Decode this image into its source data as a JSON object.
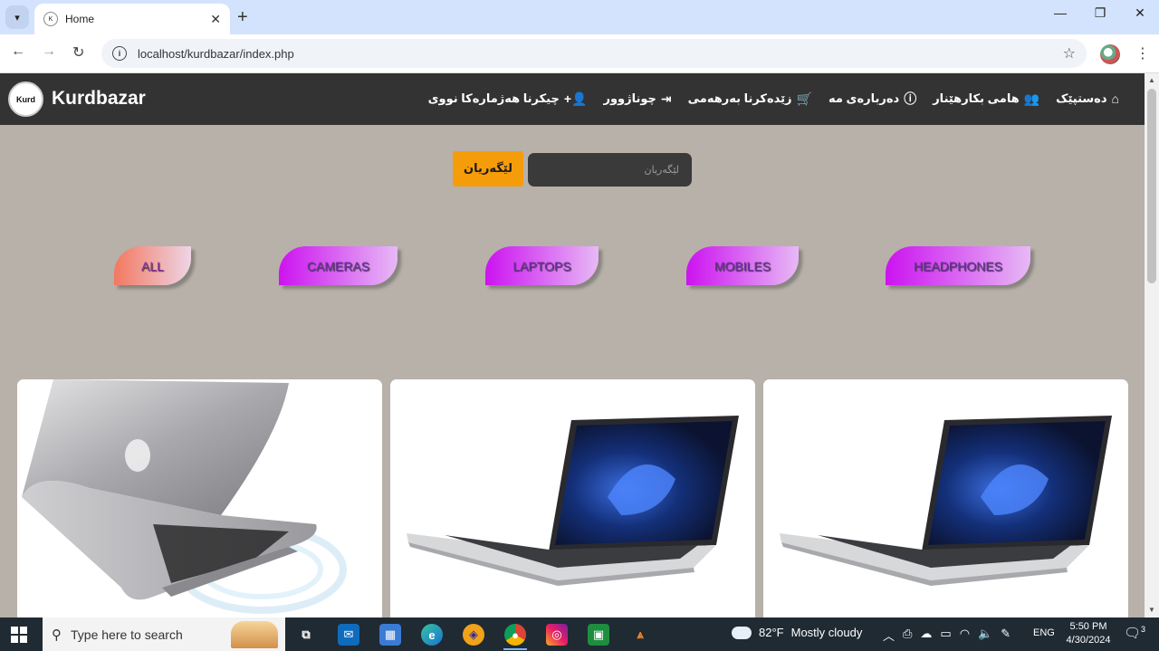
{
  "browser": {
    "tab_title": "Home",
    "url": "localhost/kurdbazar/index.php",
    "new_tab_label": "+",
    "close_tab_label": "✕"
  },
  "site": {
    "brand": "Kurdbazar",
    "logo_text": "Kurd",
    "nav": [
      {
        "label": "دەستپێک",
        "icon": "home-icon"
      },
      {
        "label": "هامی بکارهێنار",
        "icon": "users-icon"
      },
      {
        "label": "دەربارەی مە",
        "icon": "info-icon"
      },
      {
        "label": "زێدەکرنا بەرهەمی",
        "icon": "cart-icon"
      },
      {
        "label": "چوناژوور",
        "icon": "login-icon"
      },
      {
        "label": "چیکرنا هەژمارەکا نووی",
        "icon": "user-plus-icon"
      }
    ],
    "search": {
      "placeholder": "لێگەریان",
      "button_label": "لێگەریان"
    },
    "categories": [
      "ALL",
      "CAMERAS",
      "LAPTOPS",
      "MOBILES",
      "HEADPHONES"
    ],
    "products": [
      {
        "image": "silver-macbook-laptop"
      },
      {
        "image": "hp-elitebook-laptop"
      },
      {
        "image": "hp-elitebook-laptop"
      }
    ]
  },
  "taskbar": {
    "search_placeholder": "Type here to search",
    "weather_temp": "82°F",
    "weather_desc": "Mostly cloudy",
    "language": "ENG",
    "time": "5:50 PM",
    "date": "4/30/2024",
    "notifications": "3"
  }
}
